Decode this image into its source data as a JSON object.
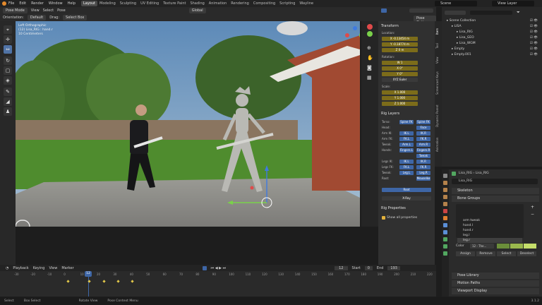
{
  "topbar": {
    "menu": [
      "File",
      "Edit",
      "Render",
      "Window",
      "Help"
    ],
    "workspaces": [
      "Layout",
      "Modeling",
      "Sculpting",
      "UV Editing",
      "Texture Paint",
      "Shading",
      "Animation",
      "Rendering",
      "Compositing",
      "Scripting",
      "Wayline"
    ],
    "active_workspace": "Layout",
    "scene_label": "Scene",
    "view_layer_label": "View Layer"
  },
  "header": {
    "mode": "Pose Mode",
    "menus": [
      "View",
      "Select",
      "Pose"
    ],
    "orientation_label": "Orientation:",
    "orientation_value": "Default",
    "drag_label": "Drag:",
    "drag_value": "Select Box",
    "transform_value": "Global",
    "pose_options": "Pose Options"
  },
  "viewport": {
    "overlay_text": [
      "Left Orthographic",
      "(12) Lisa_RIG : hand.r",
      "10 Centimeters"
    ]
  },
  "npanel": {
    "transform_title": "Transform",
    "location_label": "Location:",
    "location": [
      "X  -0.13454 m",
      "Y  -0.18774 m",
      "Z  0 m"
    ],
    "rotation_label": "Rotation:",
    "rotation": [
      "W  1",
      "X  0°",
      "Y  0°",
      "Z  14.2°"
    ],
    "rotation_mode": "XYZ Euler",
    "scale_label": "Scale:",
    "scale": [
      "X  1.000",
      "Y  1.000",
      "Z  1.000"
    ],
    "rig_layers_title": "Rig Layers",
    "rig_rows": [
      {
        "label": "Torso:",
        "buttons": [
          "Spine FK",
          "Spine FK"
        ]
      },
      {
        "label": "Head:",
        "buttons": [
          "",
          "Face"
        ]
      },
      {
        "label": "Arm IK:",
        "buttons": [
          "IK.L",
          "IK.R"
        ]
      },
      {
        "label": "Arm FK:",
        "buttons": [
          "FK.L",
          "FK.R"
        ]
      },
      {
        "label": "Tweak:",
        "buttons": [
          "Arm.L",
          "Arm.R"
        ]
      },
      {
        "label": "Hands:",
        "buttons": [
          "Fingers.L",
          "Fingers.R"
        ]
      },
      {
        "label": "",
        "buttons": [
          "",
          "Tweak"
        ]
      },
      {
        "label": "Legs IK:",
        "buttons": [
          "IK.L",
          "IK.R"
        ]
      },
      {
        "label": "Legs FK:",
        "buttons": [
          "FK.L",
          "FK.R"
        ]
      },
      {
        "label": "Tweak:",
        "buttons": [
          "Leg.L",
          "Leg.R"
        ]
      },
      {
        "label": "Root:",
        "buttons": [
          "",
          "Mouselke"
        ]
      }
    ],
    "root_button": "Root",
    "xray_button": "X-Ray",
    "rig_props_title": "Rig Properties",
    "show_all": "Show all properties"
  },
  "side_tabs": [
    "Item",
    "Tool",
    "View",
    "Screencast Keys",
    "Dynamic Parent",
    "Animation"
  ],
  "outliner": {
    "rows": [
      {
        "indent": 1,
        "label": "Scene Collection"
      },
      {
        "indent": 2,
        "label": "LISA"
      },
      {
        "indent": 3,
        "label": "Lisa_RIG"
      },
      {
        "indent": 3,
        "label": "Lisa_GEO"
      },
      {
        "indent": 3,
        "label": "Lisa_WGM"
      },
      {
        "indent": 2,
        "label": "Empty"
      },
      {
        "indent": 2,
        "label": "Empty.001"
      }
    ]
  },
  "properties": {
    "breadcrumb": [
      "Lisa_RIG",
      "Lisa_RIG"
    ],
    "object_name": "Lisa_RIG",
    "sections": [
      "Skeleton",
      "Bone Groups",
      "Pose Library",
      "Motion Paths",
      "Viewport Display"
    ],
    "bone_groups": [
      "arm tweak",
      "hand.l",
      "hand.r",
      "leg.l",
      "leg.r"
    ],
    "color_label": "Color",
    "color_value": "12 - The...",
    "assign": "Assign",
    "remove": "Remove",
    "select": "Select",
    "deselect": "Deselect"
  },
  "timeline": {
    "menus": [
      "Playback",
      "Keying",
      "View",
      "Marker"
    ],
    "current_frame": "12",
    "start_label": "Start",
    "start": "0",
    "end_label": "End",
    "end": "193",
    "ticks": [
      "-30",
      "-20",
      "-10",
      "0",
      "10",
      "20",
      "30",
      "40",
      "50",
      "60",
      "70",
      "80",
      "90",
      "100",
      "110",
      "120",
      "130",
      "140",
      "150",
      "160",
      "170",
      "180",
      "190",
      "200",
      "210",
      "220"
    ],
    "playhead": "12"
  },
  "statusbar": [
    "Select",
    "Box Select",
    "Rotate View",
    "Pose Context Menu"
  ],
  "version": "3.1.2",
  "colors": {
    "accent": "#5073a6",
    "field": "#7c6c1a",
    "bg": "#1d1d1d"
  }
}
